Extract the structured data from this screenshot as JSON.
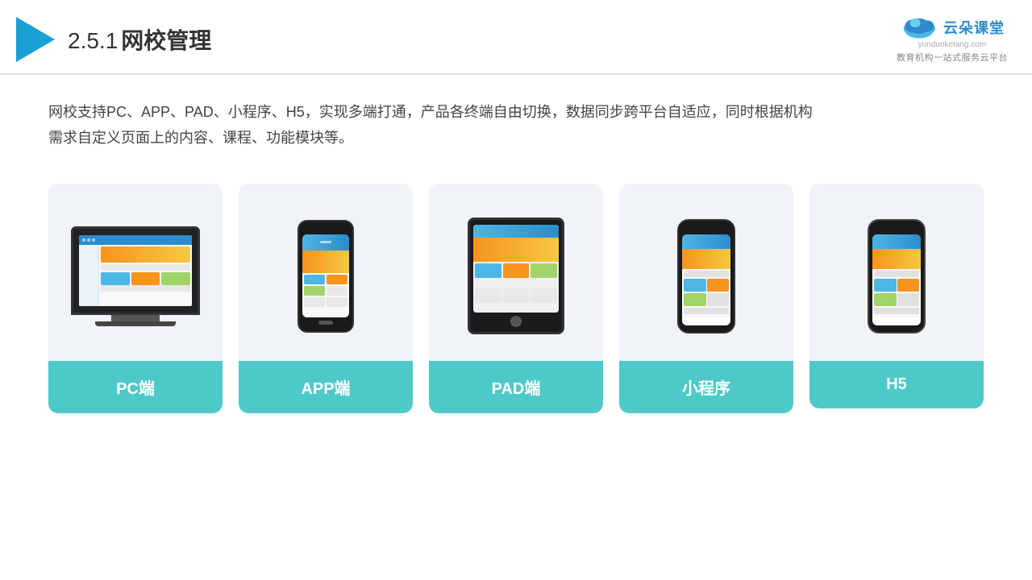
{
  "header": {
    "section_number": "2.5.1",
    "title": "网校管理",
    "logo_text": "云朵课堂",
    "logo_domain": "yunduoketang.com",
    "logo_tagline": "教育机构一站\n式服务云平台"
  },
  "description": "网校支持PC、APP、PAD、小程序、H5，实现多端打通，产品各终端自由切换，数据同步跨平台自适应，同时根据机构\n需求自定义页面上的内容、课程、功能模块等。",
  "cards": [
    {
      "id": "pc",
      "label": "PC端"
    },
    {
      "id": "app",
      "label": "APP端"
    },
    {
      "id": "pad",
      "label": "PAD端"
    },
    {
      "id": "mini",
      "label": "小程序"
    },
    {
      "id": "h5",
      "label": "H5"
    }
  ],
  "colors": {
    "accent": "#4ec9c9",
    "primary": "#2c8ccc",
    "orange": "#f7941d",
    "yellow": "#f5c842"
  }
}
